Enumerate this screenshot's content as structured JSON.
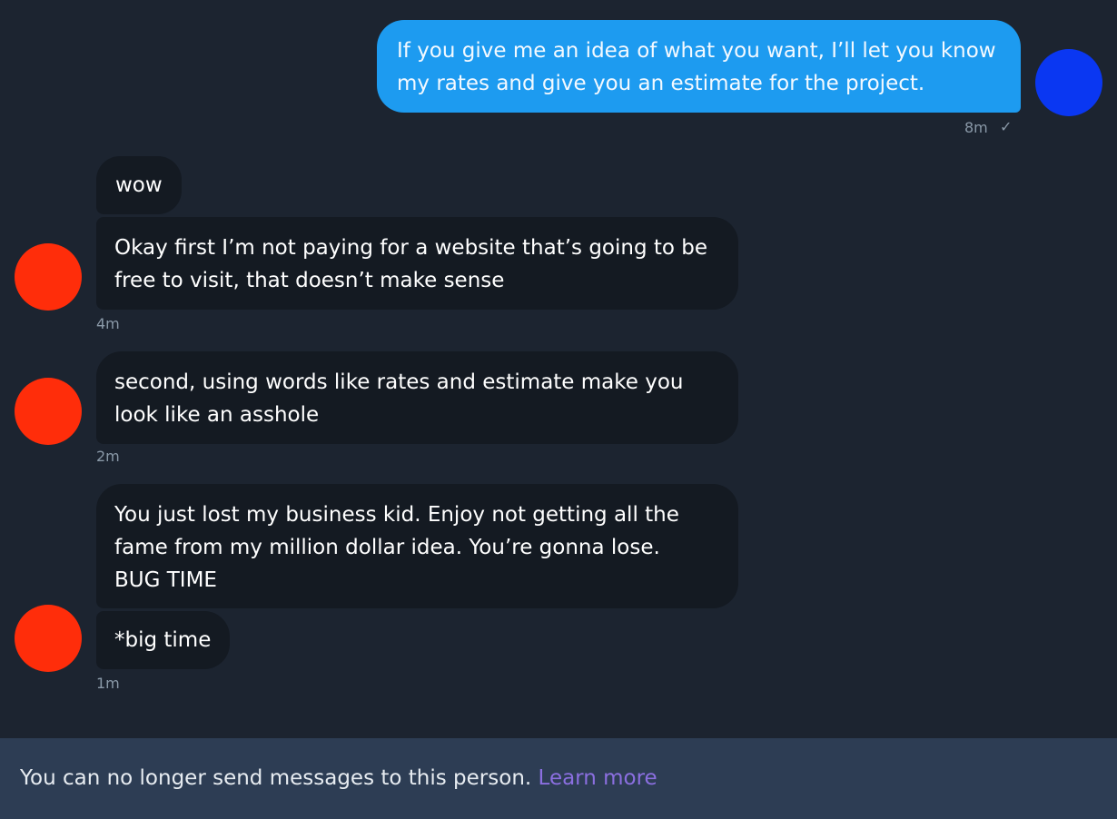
{
  "conversation": {
    "outgoing": {
      "lines": [
        "If you give me an idea of what you want, I’ll let you know",
        "my rates and give you an estimate for the project."
      ],
      "time": "8m",
      "status_icon": "checkmark-icon",
      "status_glyph": "✓"
    },
    "incoming": [
      {
        "lines": [
          "wow"
        ]
      },
      {
        "lines": [
          "Okay first I’m not paying for a website that’s going to be",
          "free to visit, that doesn’t make sense"
        ],
        "time": "4m"
      },
      {
        "lines": [
          "second, using words like rates and estimate make you",
          "look like an asshole"
        ],
        "time": "2m"
      },
      {
        "lines": [
          "You just lost my business kid. Enjoy not getting all the",
          "fame from my million dollar idea. You’re gonna lose.",
          "BUG TIME"
        ]
      },
      {
        "lines": [
          "*big time"
        ],
        "time": "1m"
      }
    ]
  },
  "colors": {
    "outgoing_bubble": "#1d9bf0",
    "incoming_bubble": "#141a22",
    "my_avatar": "#0a37f2",
    "their_avatar": "#ff2d0a",
    "footer_bg": "#2d3d54",
    "link": "#8b6fe0"
  },
  "footer": {
    "notice": "You can no longer send messages to this person.",
    "link_label": "Learn more"
  }
}
